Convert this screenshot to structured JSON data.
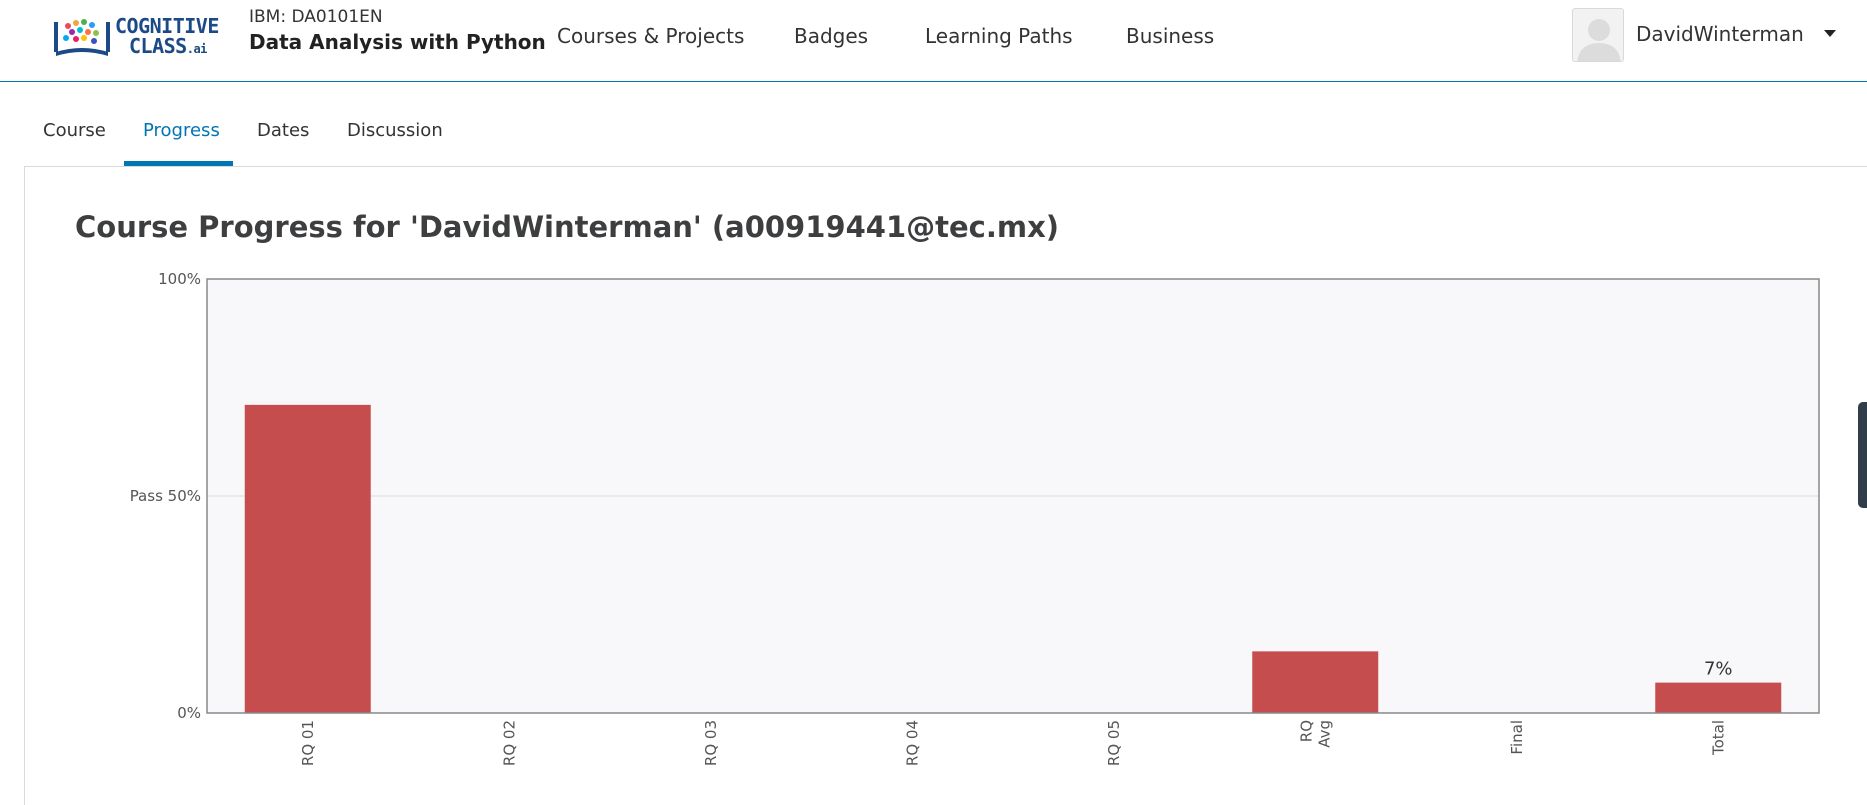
{
  "header": {
    "logo": {
      "line1": "COGNITIVE",
      "line2": "CLASS",
      "suffix": ".ai"
    },
    "course_org": "IBM: DA0101EN",
    "course_name": "Data Analysis with Python",
    "nav": [
      "Courses & Projects",
      "Badges",
      "Learning Paths",
      "Business"
    ],
    "username": "DavidWinterman"
  },
  "tabs": [
    {
      "label": "Course",
      "active": false
    },
    {
      "label": "Progress",
      "active": true
    },
    {
      "label": "Dates",
      "active": false
    },
    {
      "label": "Discussion",
      "active": false
    }
  ],
  "page": {
    "title": "Course Progress for 'DavidWinterman' (a00919441@tec.mx)"
  },
  "colors": {
    "accent": "#0075b4",
    "bar": "#c64d4e",
    "plot_bg": "#f8f8fa",
    "logo": "#1b4a86"
  },
  "chart_data": {
    "type": "bar",
    "categories": [
      "RQ 01",
      "RQ 02",
      "RQ 03",
      "RQ 04",
      "RQ 05",
      "RQ Avg",
      "Final",
      "Total"
    ],
    "category_lines": [
      [
        "RQ 01"
      ],
      [
        "RQ 02"
      ],
      [
        "RQ 03"
      ],
      [
        "RQ 04"
      ],
      [
        "RQ 05"
      ],
      [
        "RQ",
        "Avg"
      ],
      [
        "Final"
      ],
      [
        "Total"
      ]
    ],
    "values": [
      71,
      0,
      0,
      0,
      0,
      14.2,
      0,
      7
    ],
    "data_labels": [
      "",
      "",
      "",
      "",
      "",
      "",
      "",
      "7%"
    ],
    "ylim": [
      0,
      100
    ],
    "yticks": [
      {
        "value": 0,
        "label": "0%"
      },
      {
        "value": 50,
        "label": "Pass 50%"
      },
      {
        "value": 100,
        "label": "100%"
      }
    ],
    "pass_line": 50,
    "grid": false
  }
}
